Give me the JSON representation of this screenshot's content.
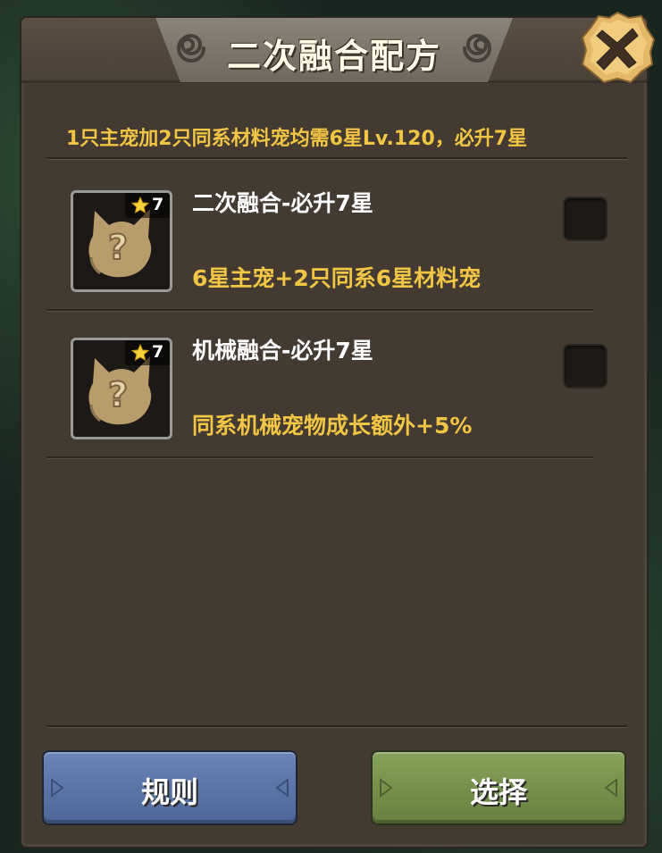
{
  "dialog": {
    "title": "二次融合配方",
    "subtitle": "1只主宠加2只同系材料宠均需6星Lv.120，必升7星"
  },
  "recipes": [
    {
      "star_level": "7",
      "name": "二次融合-必升7星",
      "description": "6星主宠+2只同系6星材料宠",
      "checked": false
    },
    {
      "star_level": "7",
      "name": "机械融合-必升7星",
      "description": "同系机械宠物成长额外+5%",
      "checked": false
    }
  ],
  "buttons": {
    "rules_label": "规则",
    "choose_label": "选择"
  },
  "icons": {
    "close": "close-icon",
    "star": "star-icon",
    "unknown_pet": "unknown-pet-icon"
  },
  "colors": {
    "panel_bg": "#433b31",
    "highlight_text": "#f3c545",
    "rules_button": "#5a73a6",
    "choose_button": "#76914c"
  }
}
